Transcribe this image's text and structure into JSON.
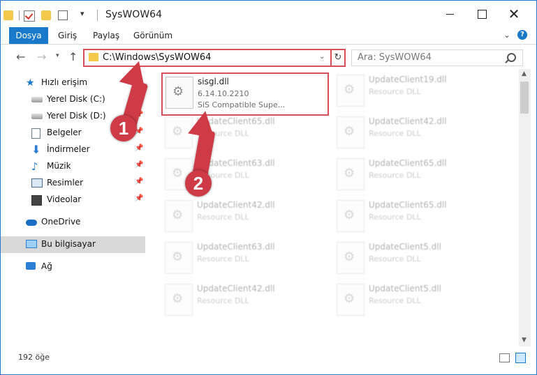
{
  "window": {
    "title": "SysWOW64",
    "controls": {
      "minimize": "—",
      "maximize": "□",
      "close": "✕"
    }
  },
  "ribbon": {
    "tabs": [
      "Dosya",
      "Giriş",
      "Paylaş",
      "Görünüm"
    ],
    "help": "?"
  },
  "navbar": {
    "address": "C:\\Windows\\SysWOW64",
    "search_placeholder": "Ara: SysWOW64"
  },
  "sidebar": {
    "items": [
      {
        "label": "Hızlı erişim",
        "icon": "star-icon"
      },
      {
        "label": "Yerel Disk (C:)",
        "icon": "disk-icon"
      },
      {
        "label": "Yerel Disk (D:)",
        "icon": "disk-icon"
      },
      {
        "label": "Belgeler",
        "icon": "documents-icon"
      },
      {
        "label": "İndirmeler",
        "icon": "downloads-icon"
      },
      {
        "label": "Müzik",
        "icon": "music-icon"
      },
      {
        "label": "Resimler",
        "icon": "pictures-icon"
      },
      {
        "label": "Videolar",
        "icon": "videos-icon"
      },
      {
        "label": "OneDrive",
        "icon": "cloud-icon"
      },
      {
        "label": "Bu bilgisayar",
        "icon": "computer-icon"
      },
      {
        "label": "Ağ",
        "icon": "network-icon"
      }
    ]
  },
  "files": [
    {
      "name": "sisgl.dll",
      "line2": "6.14.10.2210",
      "line3": "SiS Compatible Supe..."
    },
    {
      "name": "UpdateClient19.dll",
      "line2": "Resource DLL"
    },
    {
      "name": "UpdateClient65.dll",
      "line2": "Resource DLL"
    },
    {
      "name": "UpdateClient42.dll",
      "line2": "Resource DLL"
    },
    {
      "name": "UpdateClient63.dll",
      "line2": "Resource DLL"
    },
    {
      "name": "UpdateClient65.dll",
      "line2": "Resource DLL"
    },
    {
      "name": "UpdateClient42.dll",
      "line2": "Resource DLL"
    },
    {
      "name": "UpdateClient65.dll",
      "line2": "Resource DLL"
    },
    {
      "name": "UpdateClient63.dll",
      "line2": "Resource DLL"
    },
    {
      "name": "UpdateClient5.dll",
      "line2": "Resource DLL"
    },
    {
      "name": "UpdateClient42.dll",
      "line2": "Resource DLL"
    },
    {
      "name": "UpdateClient5.dll",
      "line2": "Resource DLL"
    }
  ],
  "status": {
    "item_count": "192 öğe"
  },
  "annotations": {
    "badge1": "1",
    "badge2": "2"
  },
  "colors": {
    "accent": "#1979ca",
    "annotation_red": "#cf3a47",
    "selection": "#d9d9d9"
  }
}
